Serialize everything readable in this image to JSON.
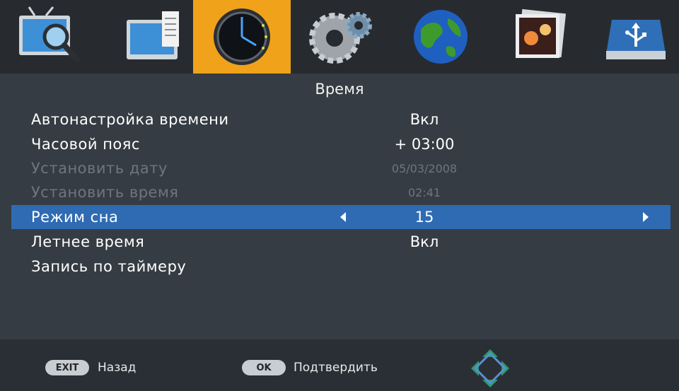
{
  "menu": {
    "tabs": [
      {
        "icon": "tv-search-icon",
        "active": false
      },
      {
        "icon": "tv-document-icon",
        "active": false
      },
      {
        "icon": "clock-icon",
        "active": true
      },
      {
        "icon": "gears-icon",
        "active": false
      },
      {
        "icon": "globe-icon",
        "active": false
      },
      {
        "icon": "photos-icon",
        "active": false
      },
      {
        "icon": "usb-drive-icon",
        "active": false
      }
    ],
    "active_color": "#f0a21a"
  },
  "page": {
    "title": "Время"
  },
  "settings": {
    "items": [
      {
        "label": "Автонастройка времени",
        "value": "Вкл"
      },
      {
        "label": "Часовой пояс",
        "value": "+ 03:00"
      },
      {
        "label": "Установить дату",
        "value": "05/03/2008"
      },
      {
        "label": "Установить время",
        "value": "02:41"
      },
      {
        "label": "Режим сна",
        "value": "15"
      },
      {
        "label": "Летнее время",
        "value": "Вкл"
      },
      {
        "label": "Запись по таймеру",
        "value": ""
      }
    ],
    "selected_color": "#2f6bb3"
  },
  "footer": {
    "exit_key": "EXIT",
    "exit_label": "Назад",
    "ok_key": "OK",
    "ok_label": "Подтвердить",
    "nav_icon": "navigation-pad-icon"
  }
}
